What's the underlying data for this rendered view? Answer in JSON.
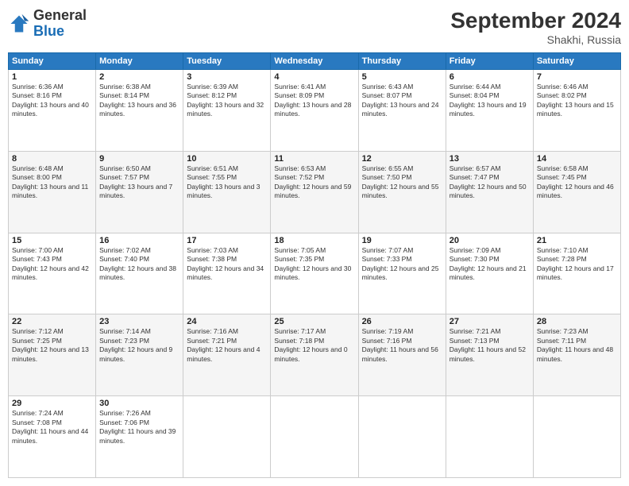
{
  "logo": {
    "line1": "General",
    "line2": "Blue"
  },
  "title": "September 2024",
  "location": "Shakhi, Russia",
  "days_header": [
    "Sunday",
    "Monday",
    "Tuesday",
    "Wednesday",
    "Thursday",
    "Friday",
    "Saturday"
  ],
  "weeks": [
    [
      {
        "num": "1",
        "sunrise": "6:36 AM",
        "sunset": "8:16 PM",
        "daylight": "13 hours and 40 minutes."
      },
      {
        "num": "2",
        "sunrise": "6:38 AM",
        "sunset": "8:14 PM",
        "daylight": "13 hours and 36 minutes."
      },
      {
        "num": "3",
        "sunrise": "6:39 AM",
        "sunset": "8:12 PM",
        "daylight": "13 hours and 32 minutes."
      },
      {
        "num": "4",
        "sunrise": "6:41 AM",
        "sunset": "8:09 PM",
        "daylight": "13 hours and 28 minutes."
      },
      {
        "num": "5",
        "sunrise": "6:43 AM",
        "sunset": "8:07 PM",
        "daylight": "13 hours and 24 minutes."
      },
      {
        "num": "6",
        "sunrise": "6:44 AM",
        "sunset": "8:04 PM",
        "daylight": "13 hours and 19 minutes."
      },
      {
        "num": "7",
        "sunrise": "6:46 AM",
        "sunset": "8:02 PM",
        "daylight": "13 hours and 15 minutes."
      }
    ],
    [
      {
        "num": "8",
        "sunrise": "6:48 AM",
        "sunset": "8:00 PM",
        "daylight": "13 hours and 11 minutes."
      },
      {
        "num": "9",
        "sunrise": "6:50 AM",
        "sunset": "7:57 PM",
        "daylight": "13 hours and 7 minutes."
      },
      {
        "num": "10",
        "sunrise": "6:51 AM",
        "sunset": "7:55 PM",
        "daylight": "13 hours and 3 minutes."
      },
      {
        "num": "11",
        "sunrise": "6:53 AM",
        "sunset": "7:52 PM",
        "daylight": "12 hours and 59 minutes."
      },
      {
        "num": "12",
        "sunrise": "6:55 AM",
        "sunset": "7:50 PM",
        "daylight": "12 hours and 55 minutes."
      },
      {
        "num": "13",
        "sunrise": "6:57 AM",
        "sunset": "7:47 PM",
        "daylight": "12 hours and 50 minutes."
      },
      {
        "num": "14",
        "sunrise": "6:58 AM",
        "sunset": "7:45 PM",
        "daylight": "12 hours and 46 minutes."
      }
    ],
    [
      {
        "num": "15",
        "sunrise": "7:00 AM",
        "sunset": "7:43 PM",
        "daylight": "12 hours and 42 minutes."
      },
      {
        "num": "16",
        "sunrise": "7:02 AM",
        "sunset": "7:40 PM",
        "daylight": "12 hours and 38 minutes."
      },
      {
        "num": "17",
        "sunrise": "7:03 AM",
        "sunset": "7:38 PM",
        "daylight": "12 hours and 34 minutes."
      },
      {
        "num": "18",
        "sunrise": "7:05 AM",
        "sunset": "7:35 PM",
        "daylight": "12 hours and 30 minutes."
      },
      {
        "num": "19",
        "sunrise": "7:07 AM",
        "sunset": "7:33 PM",
        "daylight": "12 hours and 25 minutes."
      },
      {
        "num": "20",
        "sunrise": "7:09 AM",
        "sunset": "7:30 PM",
        "daylight": "12 hours and 21 minutes."
      },
      {
        "num": "21",
        "sunrise": "7:10 AM",
        "sunset": "7:28 PM",
        "daylight": "12 hours and 17 minutes."
      }
    ],
    [
      {
        "num": "22",
        "sunrise": "7:12 AM",
        "sunset": "7:25 PM",
        "daylight": "12 hours and 13 minutes."
      },
      {
        "num": "23",
        "sunrise": "7:14 AM",
        "sunset": "7:23 PM",
        "daylight": "12 hours and 9 minutes."
      },
      {
        "num": "24",
        "sunrise": "7:16 AM",
        "sunset": "7:21 PM",
        "daylight": "12 hours and 4 minutes."
      },
      {
        "num": "25",
        "sunrise": "7:17 AM",
        "sunset": "7:18 PM",
        "daylight": "12 hours and 0 minutes."
      },
      {
        "num": "26",
        "sunrise": "7:19 AM",
        "sunset": "7:16 PM",
        "daylight": "11 hours and 56 minutes."
      },
      {
        "num": "27",
        "sunrise": "7:21 AM",
        "sunset": "7:13 PM",
        "daylight": "11 hours and 52 minutes."
      },
      {
        "num": "28",
        "sunrise": "7:23 AM",
        "sunset": "7:11 PM",
        "daylight": "11 hours and 48 minutes."
      }
    ],
    [
      {
        "num": "29",
        "sunrise": "7:24 AM",
        "sunset": "7:08 PM",
        "daylight": "11 hours and 44 minutes."
      },
      {
        "num": "30",
        "sunrise": "7:26 AM",
        "sunset": "7:06 PM",
        "daylight": "11 hours and 39 minutes."
      },
      null,
      null,
      null,
      null,
      null
    ]
  ],
  "labels": {
    "sunrise": "Sunrise:",
    "sunset": "Sunset:",
    "daylight": "Daylight:"
  }
}
